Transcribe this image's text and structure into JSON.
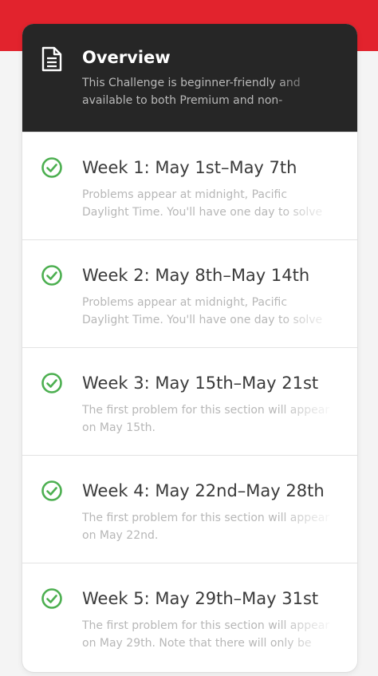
{
  "colors": {
    "accent_red": "#e2232d",
    "header_bg": "#262626",
    "check_green": "#4caf50"
  },
  "overview": {
    "icon": "document-icon",
    "title": "Overview",
    "description": "This Challenge is beginner-friendly and available to both Premium and non-Premium users."
  },
  "weeks": [
    {
      "icon": "check-circle-icon",
      "title": "Week 1: May 1st–May 7th",
      "description": "Problems appear at midnight, Pacific Daylight Time. You'll have one day to solve each problem."
    },
    {
      "icon": "check-circle-icon",
      "title": "Week 2: May 8th–May 14th",
      "description": "Problems appear at midnight, Pacific Daylight Time. You'll have one day to solve each problem."
    },
    {
      "icon": "check-circle-icon",
      "title": "Week 3: May 15th–May 21st",
      "description": "The first problem for this section will appear on May 15th."
    },
    {
      "icon": "check-circle-icon",
      "title": "Week 4: May 22nd–May 28th",
      "description": "The first problem for this section will appear on May 22nd."
    },
    {
      "icon": "check-circle-icon",
      "title": "Week 5: May 29th–May 31st",
      "description": "The first problem for this section will appear on May 29th. Note that there will only be three days in this section."
    }
  ]
}
